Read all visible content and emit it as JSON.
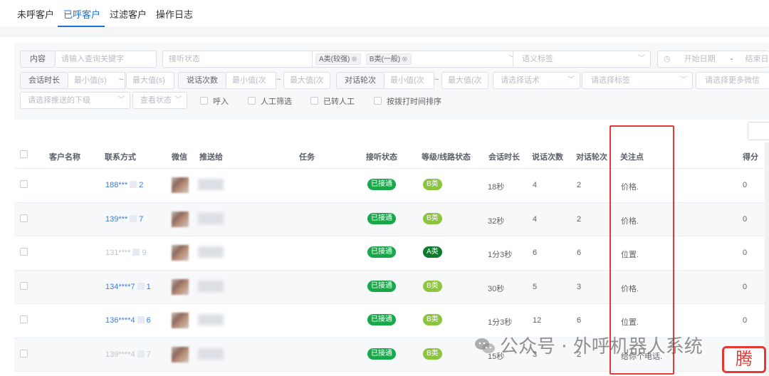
{
  "tabs": [
    {
      "label": "未呼客户"
    },
    {
      "label": "已呼客户"
    },
    {
      "label": "过滤客户"
    },
    {
      "label": "操作日志"
    }
  ],
  "filters": {
    "content_label": "内容",
    "keyword_placeholder": "请输入查询关键字",
    "answer_status_placeholder": "接听状态",
    "chips": [
      {
        "label": "A类(较强)"
      },
      {
        "label": "B类(一般)"
      }
    ],
    "intent_tag_placeholder": "语义标签",
    "start_date_placeholder": "开始日期",
    "date_separator": "-",
    "end_date_placeholder": "结束日期",
    "duration_label": "会话时长",
    "duration_min": "最小值(s)",
    "duration_max": "最大值(s)",
    "talk_count_label": "说话次数",
    "talk_count_min": "最小值(次",
    "talk_count_max": "最大值(次",
    "rounds_label": "对话轮次",
    "rounds_min": "最小值(次",
    "rounds_max": "最大值(次",
    "script_placeholder": "请选择话术",
    "tag_placeholder": "请选择标签",
    "wechat_placeholder": "请选择更多微信",
    "push_placeholder": "请选择推送的下级",
    "view_status_placeholder": "查看状态",
    "checkboxes": [
      {
        "label": "呼入"
      },
      {
        "label": "人工筛选"
      },
      {
        "label": "已转人工"
      },
      {
        "label": "按拨打时间排序"
      }
    ]
  },
  "table": {
    "headers": [
      "客户名称",
      "联系方式",
      "微信",
      "推送给",
      "任务",
      "接听状态",
      "等级/线路状态",
      "会话时长",
      "说话次数",
      "对话轮次",
      "关注点",
      "得分"
    ],
    "rows": [
      {
        "phone_a": "188***",
        "phone_b": "2",
        "phone_style": "link",
        "status": "已接通",
        "level": "B类",
        "level_style": "lime",
        "duration": "18秒",
        "talk": "4",
        "rounds": "2",
        "focus": "价格.",
        "score": "0"
      },
      {
        "phone_a": "139***",
        "phone_b": "7",
        "phone_style": "link",
        "status": "已接通",
        "level": "B类",
        "level_style": "lime",
        "duration": "32秒",
        "talk": "4",
        "rounds": "2",
        "focus": "价格.",
        "score": "0"
      },
      {
        "phone_a": "131****",
        "phone_b": "9",
        "phone_style": "dim",
        "status": "已接通",
        "level": "A类",
        "level_style": "dark",
        "duration": "1分3秒",
        "talk": "6",
        "rounds": "6",
        "focus": "位置.",
        "score": "0"
      },
      {
        "phone_a": "134****7",
        "phone_b": "1",
        "phone_style": "link",
        "status": "已接通",
        "level": "B类",
        "level_style": "lime",
        "duration": "30秒",
        "talk": "5",
        "rounds": "3",
        "focus": "价格.",
        "score": "0"
      },
      {
        "phone_a": "136****4",
        "phone_b": "6",
        "phone_style": "link",
        "status": "已接通",
        "level": "B类",
        "level_style": "lime",
        "duration": "1分3秒",
        "talk": "12",
        "rounds": "6",
        "focus": "位置.",
        "score": "0"
      },
      {
        "phone_a": "139****4",
        "phone_b": "7",
        "phone_style": "dim",
        "status": "已接通",
        "level": "B类",
        "level_style": "lime",
        "duration": "15秒",
        "talk": "3",
        "rounds": "2",
        "focus": "给你个电话.",
        "score": "0"
      }
    ]
  },
  "watermark": {
    "text": "公众号 · 外呼机器人系统",
    "icon": "wechat-icon"
  },
  "badge": {
    "text": "腾"
  },
  "colors": {
    "primary": "#1e6fd9",
    "tag_green": "#18a84a",
    "tag_lime": "#8cc43e",
    "tag_dark": "#0d7a2e",
    "highlight": "#e53935"
  }
}
